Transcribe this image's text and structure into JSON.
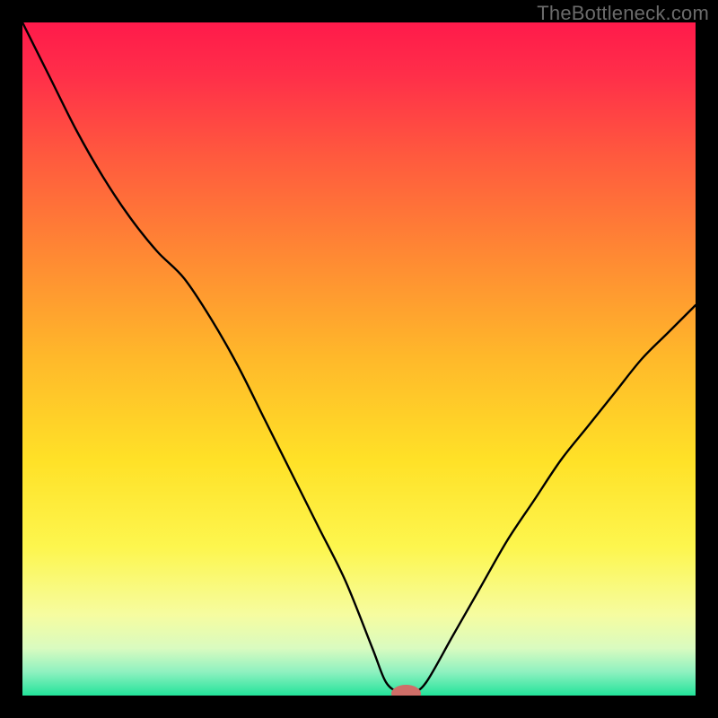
{
  "watermark": "TheBottleneck.com",
  "chart_data": {
    "type": "line",
    "title": "",
    "xlabel": "",
    "ylabel": "",
    "xlim": [
      0,
      100
    ],
    "ylim": [
      0,
      100
    ],
    "grid": false,
    "legend": false,
    "background_gradient_stops": [
      {
        "offset": 0.0,
        "color": "#ff1a4b"
      },
      {
        "offset": 0.08,
        "color": "#ff2f49"
      },
      {
        "offset": 0.2,
        "color": "#ff5a3e"
      },
      {
        "offset": 0.35,
        "color": "#ff8a33"
      },
      {
        "offset": 0.5,
        "color": "#ffb92a"
      },
      {
        "offset": 0.65,
        "color": "#ffe127"
      },
      {
        "offset": 0.78,
        "color": "#fdf64e"
      },
      {
        "offset": 0.88,
        "color": "#f6fca0"
      },
      {
        "offset": 0.93,
        "color": "#d9fbc0"
      },
      {
        "offset": 0.965,
        "color": "#8ef1c0"
      },
      {
        "offset": 1.0,
        "color": "#23e39a"
      }
    ],
    "series": [
      {
        "name": "bottleneck-curve",
        "color": "#000000",
        "width": 2.4,
        "x": [
          0.0,
          4.0,
          8.0,
          12.0,
          16.0,
          20.0,
          24.0,
          28.0,
          32.0,
          36.0,
          40.0,
          44.0,
          48.0,
          52.0,
          54.0,
          56.0,
          58.0,
          60.0,
          64.0,
          68.0,
          72.0,
          76.0,
          80.0,
          84.0,
          88.0,
          92.0,
          96.0,
          100.0
        ],
        "y": [
          100.0,
          92.0,
          84.0,
          77.0,
          71.0,
          66.0,
          62.0,
          56.0,
          49.0,
          41.0,
          33.0,
          25.0,
          17.0,
          7.0,
          2.0,
          0.5,
          0.5,
          2.0,
          9.0,
          16.0,
          23.0,
          29.0,
          35.0,
          40.0,
          45.0,
          50.0,
          54.0,
          58.0
        ]
      }
    ],
    "marker": {
      "name": "optimal-point",
      "x": 57.0,
      "y": 0.3,
      "rx": 2.2,
      "ry": 1.3,
      "color": "#cf6e68"
    }
  }
}
